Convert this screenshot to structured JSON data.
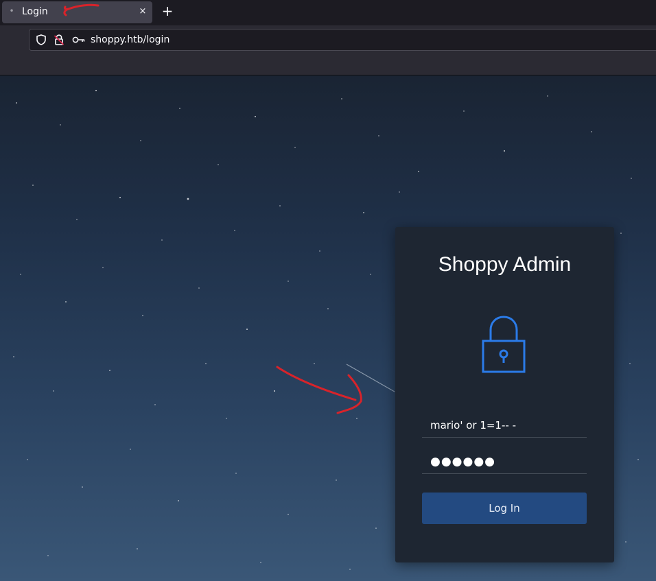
{
  "browser": {
    "tab": {
      "title": "Login",
      "favicon": "•",
      "close": "×"
    },
    "new_tab": "+",
    "url": "shoppy.htb/login"
  },
  "login": {
    "title": "Shoppy Admin",
    "username_value": "mario' or 1=1-- -",
    "password_value": "●●●●●●",
    "button_label": "Log In"
  },
  "colors": {
    "card_bg": "#1e2632",
    "accent": "#2b7be8",
    "button": "#234a81",
    "annotation": "#d8232a"
  },
  "icons": {
    "shield": "shield-icon",
    "lock_slash": "insecure-lock-icon",
    "key": "key-icon",
    "padlock": "padlock-icon"
  }
}
